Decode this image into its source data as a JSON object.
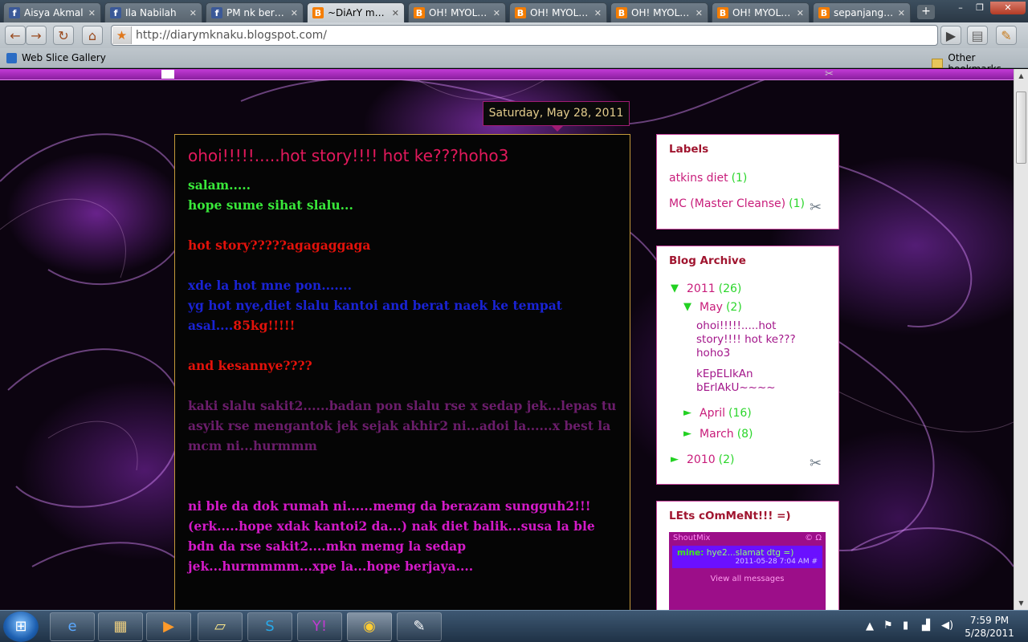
{
  "browser": {
    "tabs": [
      {
        "title": "Aisya Akmal",
        "favicon": "facebook-icon",
        "active": false
      },
      {
        "title": "Ila Nabilah",
        "favicon": "facebook-icon",
        "active": false
      },
      {
        "title": "PM nk beru...",
        "favicon": "facebook-icon",
        "active": false
      },
      {
        "title": "~DiArY mA...",
        "favicon": "blogger-icon",
        "active": true
      },
      {
        "title": "OH! MYOLI...",
        "favicon": "blogger-icon",
        "active": false
      },
      {
        "title": "OH! MYOLI...",
        "favicon": "blogger-icon",
        "active": false
      },
      {
        "title": "OH! MYOLI...",
        "favicon": "blogger-icon",
        "active": false
      },
      {
        "title": "OH! MYOLIZA",
        "favicon": "blogger-icon",
        "active": false
      },
      {
        "title": "sepanjang j...",
        "favicon": "blogger-icon",
        "active": false
      }
    ],
    "url": "http://diarymknaku.blogspot.com/",
    "bookmarks": {
      "left": "Web Slice Gallery",
      "right": "Other bookmarks"
    }
  },
  "blog": {
    "date_header": "Saturday, May 28, 2011",
    "post_title": "ohoi!!!!!.....hot story!!!! hot ke???hoho3",
    "body": [
      {
        "text": "salam.....",
        "color": "green"
      },
      {
        "text": "hope sume sihat slalu...",
        "color": "green"
      },
      {
        "text": "",
        "color": "gap"
      },
      {
        "text": "hot story?????agagaggaga",
        "color": "red"
      },
      {
        "text": "",
        "color": "gap"
      },
      {
        "text": "xde la hot mne pon.......",
        "color": "blue"
      },
      {
        "text": "yg hot nye,diet slalu kantoi and berat naek ke tempat asal....",
        "color": "blue",
        "suffix": "85kg!!!!!"
      },
      {
        "text": "",
        "color": "gap"
      },
      {
        "text": "and kesannye????",
        "color": "red"
      },
      {
        "text": "",
        "color": "gap"
      },
      {
        "text": "kaki slalu sakit2......badan pon slalu rse x sedap jek...lepas tu asyik rse mengantok jek sejak akhir2 ni...adoi la......x best la mcm ni...hurmmm",
        "color": "purple"
      },
      {
        "text": "",
        "color": "gap"
      },
      {
        "text": "",
        "color": "gap"
      },
      {
        "text": "ni ble da dok rumah ni......memg da berazam sungguh2!!!(erk.....hope xdak kantoi2 da...) nak diet balik...susa la ble bdn da rse sakit2....mkn memg la sedap jek...hurmmmm...xpe la...hope berjaya....",
        "color": "magenta"
      }
    ],
    "labels_widget": {
      "title": "Labels",
      "items": [
        {
          "name": "atkins diet",
          "count": "(1)"
        },
        {
          "name": "MC (Master Cleanse)",
          "count": "(1)"
        }
      ]
    },
    "archive_widget": {
      "title": "Blog Archive",
      "year_2011": {
        "label": "2011",
        "count": "(26)",
        "toggle": "▼"
      },
      "may": {
        "label": "May",
        "count": "(2)",
        "toggle": "▼"
      },
      "posts": [
        "ohoi!!!!!.....hot story!!!! hot ke???hoho3",
        "kEpELIkAn bErlAkU~~~~"
      ],
      "april": {
        "label": "April",
        "count": "(16)",
        "toggle": "►"
      },
      "march": {
        "label": "March",
        "count": "(8)",
        "toggle": "►"
      },
      "year_2010": {
        "label": "2010",
        "count": "(2)",
        "toggle": "►"
      }
    },
    "comment_widget": {
      "title": "LEts cOmMeNt!!! =)",
      "shoutbox_brand": "ShoutMix",
      "shoutbox_icons": "© Ω",
      "message_user": "mine:",
      "message_text": "hye2...slamat dtg =)",
      "message_time": "2011-05-28 7:04 AM #",
      "view_all": "View all messages"
    }
  },
  "taskbar": {
    "time": "7:59 PM",
    "date": "5/28/2011"
  }
}
